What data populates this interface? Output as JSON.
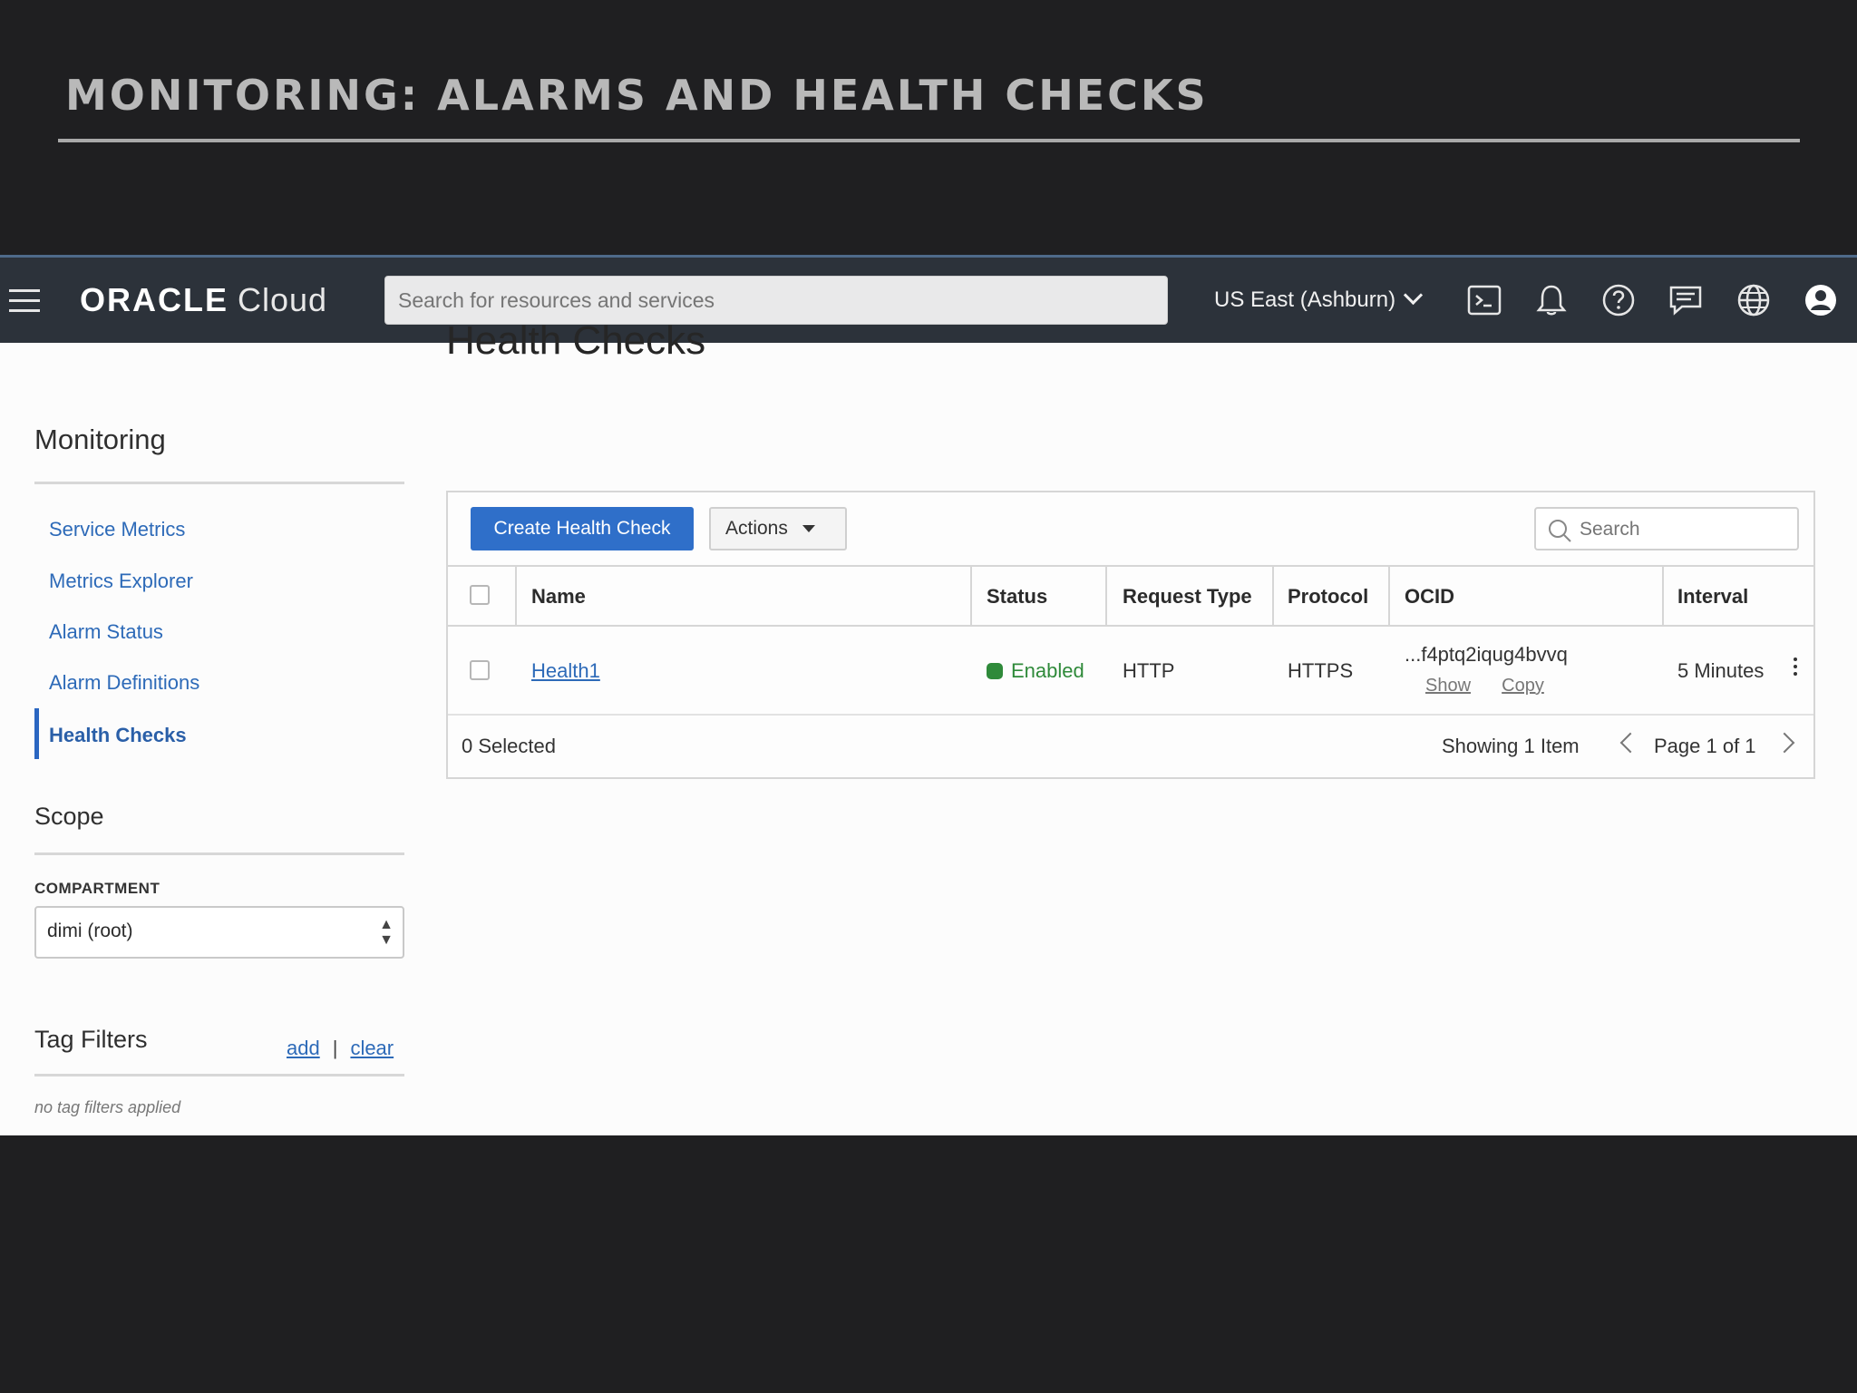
{
  "slide": {
    "title": "MONITORING: ALARMS AND HEALTH CHECKS"
  },
  "topbar": {
    "logo_bold": "ORACLE",
    "logo_light": "Cloud",
    "search_placeholder": "Search for resources and services",
    "region": "US East (Ashburn)",
    "icons": [
      "menu-icon",
      "cloud-shell-icon",
      "bell-icon",
      "help-icon",
      "chat-icon",
      "globe-icon",
      "user-icon"
    ]
  },
  "sidebar": {
    "heading": "Monitoring",
    "items": [
      {
        "label": "Service Metrics",
        "active": false
      },
      {
        "label": "Metrics Explorer",
        "active": false
      },
      {
        "label": "Alarm Status",
        "active": false
      },
      {
        "label": "Alarm Definitions",
        "active": false
      },
      {
        "label": "Health Checks",
        "active": true
      }
    ],
    "scope_heading": "Scope",
    "compartment_label": "COMPARTMENT",
    "compartment_value": "dimi (root)",
    "tag_heading": "Tag Filters",
    "tag_add": "add",
    "tag_sep": "|",
    "tag_clear": "clear",
    "tag_empty": "no tag filters applied"
  },
  "main": {
    "title": "Health Checks",
    "create_button": "Create Health Check",
    "actions_button": "Actions",
    "search_placeholder": "Search",
    "columns": [
      "Name",
      "Status",
      "Request Type",
      "Protocol",
      "OCID",
      "Interval"
    ],
    "rows": [
      {
        "name": "Health1",
        "status": "Enabled",
        "request_type": "HTTP",
        "protocol": "HTTPS",
        "ocid": "...f4ptq2iqug4bvvq",
        "ocid_show": "Show",
        "ocid_copy": "Copy",
        "interval": "5 Minutes"
      }
    ],
    "selected_text": "0 Selected",
    "showing_text": "Showing 1 Item",
    "page_text": "Page 1 of 1"
  },
  "colors": {
    "topbar_bg": "#2c323a",
    "primary_button": "#2f6fc9",
    "link": "#2d6ab8",
    "status_enabled": "#2f8a3a",
    "slide_bg": "#1f1f21"
  }
}
